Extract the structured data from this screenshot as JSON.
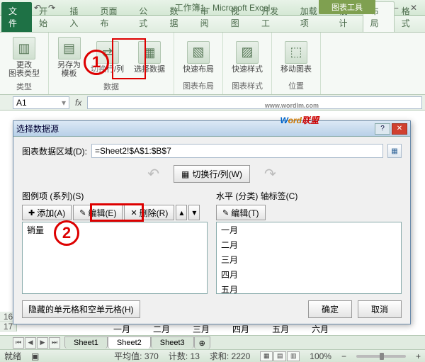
{
  "title": "工作簿1 - Microsoft Excel",
  "context_tab": "图表工具",
  "tabs": {
    "file": "文件",
    "home": "开始",
    "insert": "插入",
    "pagelayout": "页面布",
    "formulas": "公式",
    "data": "数据",
    "review": "审阅",
    "view": "视图",
    "developer": "开发工",
    "addins": "加载项",
    "design": "设计",
    "layout": "布局",
    "format": "格式"
  },
  "ribbon": {
    "group_type": {
      "btn1": "更改\n图表类型",
      "label": "类型"
    },
    "group_data": {
      "btn1": "另存为\n模板",
      "btn2": "切换行/列",
      "btn3": "选择数据",
      "label": "数据"
    },
    "group_layout": {
      "btn": "快速布局",
      "label": "图表布局"
    },
    "group_style": {
      "btn": "快速样式",
      "label": "图表样式"
    },
    "group_loc": {
      "btn": "移动图表",
      "label": "位置"
    }
  },
  "namebox": "A1",
  "watermark": {
    "sub": "www.wordlm.com",
    "w": "W",
    "ord": "ord",
    "lm": "联盟"
  },
  "dialog": {
    "title": "选择数据源",
    "range_label": "图表数据区域(D):",
    "range_value": "=Sheet2!$A$1:$B$7",
    "switch_btn": "切换行/列(W)",
    "legend_label": "图例项 (系列)(S)",
    "axis_label": "水平 (分类) 轴标签(C)",
    "add": "添加(A)",
    "edit": "编辑(E)",
    "delete": "删除(R)",
    "edit2": "编辑(T)",
    "series": [
      "销量"
    ],
    "categories": [
      "一月",
      "二月",
      "三月",
      "四月",
      "五月"
    ],
    "hidden": "隐藏的单元格和空单元格(H)",
    "ok": "确定",
    "cancel": "取消"
  },
  "callouts": {
    "one": "1",
    "two": "2"
  },
  "months": [
    "一月",
    "二月",
    "三月",
    "四月",
    "五月",
    "六月"
  ],
  "rows": [
    "16",
    "17"
  ],
  "sheets": {
    "s1": "Sheet1",
    "s2": "Sheet2",
    "s3": "Sheet3"
  },
  "status": {
    "ready": "就绪",
    "avg": "平均值: 370",
    "count": "计数: 13",
    "sum": "求和: 2220",
    "zoom": "100%"
  }
}
